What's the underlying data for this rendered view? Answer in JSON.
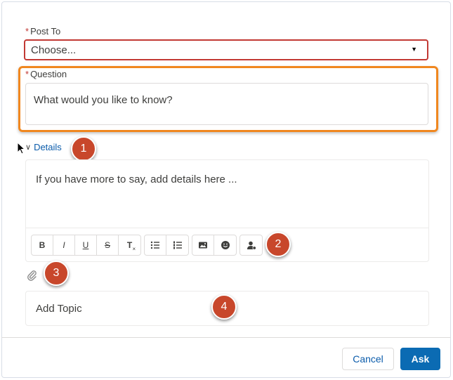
{
  "post_to": {
    "required_mark": "*",
    "label": "Post To",
    "value": "Choose...",
    "caret": "▼"
  },
  "question": {
    "required_mark": "*",
    "label": "Question",
    "placeholder": "What would you like to know?"
  },
  "details": {
    "toggle_icon": "∨",
    "label": "Details",
    "placeholder": "If you have more to say, add details here ..."
  },
  "toolbar": {
    "bold": "B",
    "italic": "I",
    "underline": "U",
    "strikethrough": "S",
    "clear_format": "T",
    "icons": [
      "bold-icon",
      "italic-icon",
      "underline-icon",
      "strikethrough-icon",
      "clear-format-icon",
      "bulleted-list-icon",
      "numbered-list-icon",
      "image-icon",
      "emoji-icon",
      "mention-icon"
    ]
  },
  "attachment_icon": "paperclip-icon",
  "topic": {
    "placeholder": "Add Topic"
  },
  "callouts": [
    "1",
    "2",
    "3",
    "4"
  ],
  "buttons": {
    "cancel": "Cancel",
    "ask": "Ask"
  },
  "colors": {
    "error_border": "#c23934",
    "highlight_border": "#f0871f",
    "callout": "#c8472b",
    "link": "#0b5cab",
    "primary": "#0b6bb3"
  }
}
